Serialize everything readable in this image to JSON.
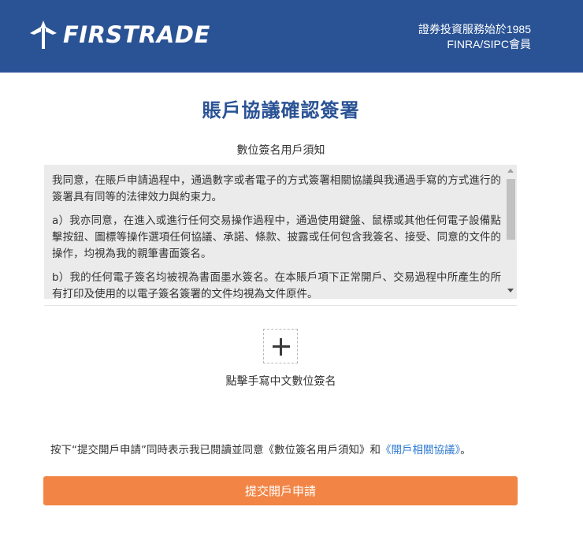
{
  "header": {
    "brand_name": "FIRSTRADE",
    "tagline_line1": "證券投資服務始於1985",
    "tagline_line2": "FINRA/SIPC會員"
  },
  "page": {
    "title": "賬戶協議確認簽署",
    "subtitle": "數位簽名用戶須知"
  },
  "notice": {
    "paragraphs": [
      "我同意，在賬戶申請過程中，通過數字或者電子的方式簽署相關協議與我通過手寫的方式進行的簽署具有同等的法律效力與約束力。",
      "a）我亦同意，在進入或進行任何交易操作過程中，通過使用鍵盤、鼠標或其他任何電子設備點擊按鈕、圖標等操作選項任何協議、承諾、條款、披露或任何包含我簽名、接受、同意的文件的操作，均視為我的親筆書面簽名。",
      "b）我的任何電子簽名均被視為書面墨水簽名。在本賬戶項下正常開戶、交易過程中所產生的所有打印及使用的以電子簽名簽署的文件均視為文件原件。"
    ]
  },
  "signature": {
    "label": "點擊手寫中文數位簽名"
  },
  "agreement": {
    "prefix": "按下“提交開戶申請”同時表示我已閱讀並同意《數位簽名用戶須知》和",
    "link_text": "《開戶相關協議》",
    "suffix": "。"
  },
  "submit": {
    "label": "提交開戶申請"
  },
  "colors": {
    "header_bg": "#2a5395",
    "title": "#2a5395",
    "notice_bg": "#ebebeb",
    "link": "#2f7bd0",
    "submit_bg": "#f28545"
  },
  "icons": {
    "logo": "firstrade-arrow-logo-icon",
    "add_signature": "plus-icon"
  }
}
